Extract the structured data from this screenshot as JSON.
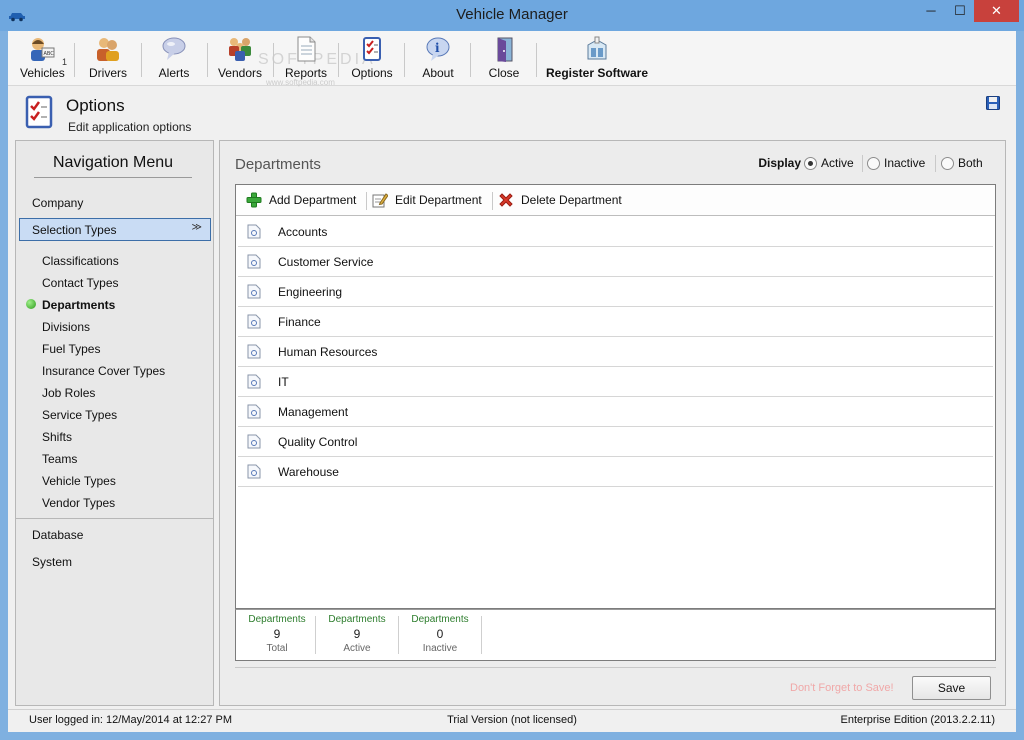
{
  "window": {
    "title": "Vehicle Manager",
    "controls": [
      "─",
      "☐",
      "✕"
    ]
  },
  "toolbar": {
    "items": [
      {
        "label": "Vehicles",
        "icon": "vehicles-icon",
        "badge": "1"
      },
      {
        "label": "Drivers",
        "icon": "drivers-icon"
      },
      {
        "label": "Alerts",
        "icon": "alerts-icon"
      },
      {
        "label": "Vendors",
        "icon": "vendors-icon"
      },
      {
        "label": "Reports",
        "icon": "reports-icon"
      },
      {
        "label": "Options",
        "icon": "options-icon"
      },
      {
        "label": "About",
        "icon": "about-icon"
      },
      {
        "label": "Close",
        "icon": "close-door-icon"
      },
      {
        "label": "Register Software",
        "icon": "register-icon"
      }
    ],
    "watermark": "SOFTPEDIA",
    "watermark_url": "www.softpedia.com"
  },
  "header": {
    "title": "Options",
    "subtitle": "Edit application options"
  },
  "nav": {
    "title": "Navigation Menu",
    "company": "Company",
    "selection_types": "Selection Types",
    "chevron": "≫",
    "sub_items": [
      "Classifications",
      "Contact Types",
      "Departments",
      "Divisions",
      "Fuel Types",
      "Insurance Cover Types",
      "Job Roles",
      "Service Types",
      "Shifts",
      "Teams",
      "Vehicle Types",
      "Vendor Types"
    ],
    "active_item": "Departments",
    "database": "Database",
    "system": "System"
  },
  "content": {
    "title": "Departments",
    "display": {
      "label": "Display",
      "options": [
        "Active",
        "Inactive",
        "Both"
      ],
      "selected": "Active"
    },
    "actions": {
      "add": "Add Department",
      "edit": "Edit Department",
      "delete": "Delete Department"
    },
    "rows": [
      "Accounts",
      "Customer Service",
      "Engineering",
      "Finance",
      "Human Resources",
      "IT",
      "Management",
      "Quality Control",
      "Warehouse"
    ],
    "stats": [
      {
        "header": "Departments",
        "value": "9",
        "label": "Total"
      },
      {
        "header": "Departments",
        "value": "9",
        "label": "Active"
      },
      {
        "header": "Departments",
        "value": "0",
        "label": "Inactive"
      }
    ],
    "reminder": "Don't Forget to Save!",
    "save_label": "Save"
  },
  "status": {
    "user": "User logged in:  12/May/2014 at 12:27 PM",
    "license": "Trial Version (not licensed)",
    "edition": "Enterprise Edition (2013.2.2.11)"
  },
  "colors": {
    "title_bar": "#6ea7df",
    "close_button": "#c8413c",
    "selected_nav": "#c9dcf4",
    "active_dot": "#2c9a1c",
    "stat_header": "#2d7d2d",
    "reminder": "#f0a8a8"
  }
}
